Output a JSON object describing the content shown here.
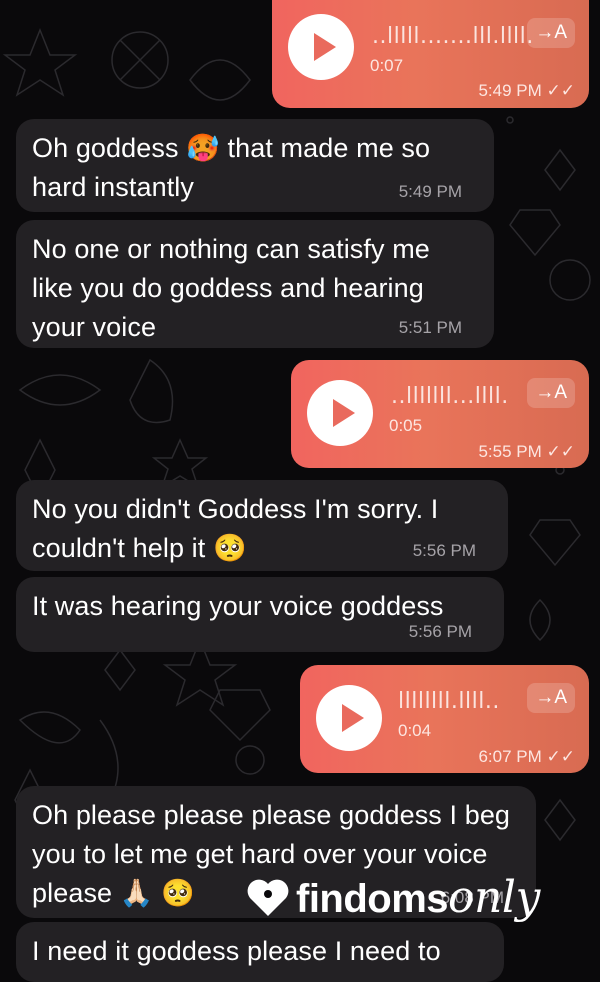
{
  "conversation": {
    "messages": [
      {
        "type": "voice",
        "direction": "outgoing",
        "waveform": "..lllll.......lll.llll.",
        "duration": "0:07",
        "transcribe_label": "→A",
        "time": "5:49 PM"
      },
      {
        "type": "text",
        "direction": "incoming",
        "text": "Oh goddess 🥵 that made me so hard instantly",
        "time": "5:49 PM"
      },
      {
        "type": "text",
        "direction": "incoming",
        "text": "No one or nothing can satisfy me like you do goddess and hearing your voice",
        "time": "5:51 PM"
      },
      {
        "type": "voice",
        "direction": "outgoing",
        "waveform": "..lllllll...llll.",
        "duration": "0:05",
        "transcribe_label": "→A",
        "time": "5:55 PM"
      },
      {
        "type": "text",
        "direction": "incoming",
        "text": "No you didn't Goddess I'm sorry. I couldn't help it 🥺",
        "time": "5:56 PM"
      },
      {
        "type": "text",
        "direction": "incoming",
        "text": "It was hearing your voice goddess",
        "time": "5:56 PM"
      },
      {
        "type": "voice",
        "direction": "outgoing",
        "waveform": "llllllll.llll..",
        "duration": "0:04",
        "transcribe_label": "→A",
        "time": "6:07 PM"
      },
      {
        "type": "text",
        "direction": "incoming",
        "text": "Oh please please please goddess I beg you to let me get hard over your voice please 🙏🏻 🥺",
        "time": "6:08 PM"
      },
      {
        "type": "text",
        "direction": "incoming",
        "text": "I need it goddess please I need to",
        "time": ""
      }
    ],
    "read_receipt_icon": "double-check-icon"
  },
  "watermark": {
    "bold": "findoms",
    "script": "only"
  },
  "colors": {
    "incoming_bubble": "#232124",
    "outgoing_gradient_start": "#f1655f",
    "outgoing_gradient_end": "#d86b52",
    "background": "#0a090b"
  }
}
